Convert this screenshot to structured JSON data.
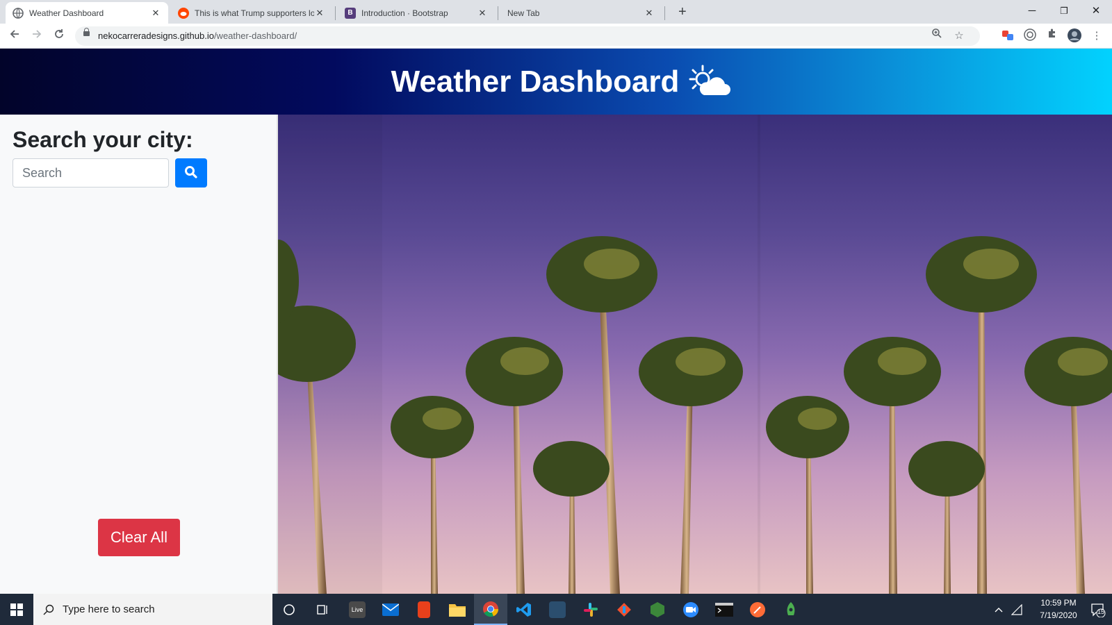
{
  "browser": {
    "tabs": [
      {
        "title": "Weather Dashboard",
        "active": true,
        "favicon_color": "#5f6368"
      },
      {
        "title": "This is what Trump supporters lo",
        "active": false,
        "favicon_color": "#ff4500"
      },
      {
        "title": "Introduction · Bootstrap",
        "active": false,
        "favicon_color": "#563d7c"
      },
      {
        "title": "New Tab",
        "active": false,
        "favicon_color": ""
      }
    ],
    "new_tab_label": "+",
    "url_host": "nekocarreradesigns.github.io",
    "url_path": "/weather-dashboard/",
    "window_controls": {
      "minimize": "─",
      "restore": "❐",
      "close": "✕"
    }
  },
  "header": {
    "title": "Weather Dashboard",
    "icon": "sun-cloud-icon",
    "gradient_colors": [
      "#02042a",
      "#020a5e",
      "#02d2fe"
    ]
  },
  "sidebar": {
    "heading": "Search your city:",
    "search_placeholder": "Search",
    "search_value": "",
    "search_button_icon": "search-icon",
    "clear_label": "Clear All",
    "colors": {
      "primary": "#007bff",
      "danger": "#dc3545"
    }
  },
  "taskbar": {
    "search_placeholder": "Type here to search",
    "time": "10:59 PM",
    "date": "7/19/2020",
    "notification_count": "15",
    "live_label": "Live",
    "apps": [
      "cortana-icon",
      "task-view-icon",
      "live-icon",
      "mail-icon",
      "office-icon",
      "file-explorer-icon",
      "chrome-icon",
      "vscode-icon",
      "mysql-workbench-icon",
      "slack-icon",
      "git-icon",
      "nodejs-icon",
      "zoom-icon",
      "terminal-icon",
      "postman-icon",
      "robo3t-icon"
    ]
  }
}
